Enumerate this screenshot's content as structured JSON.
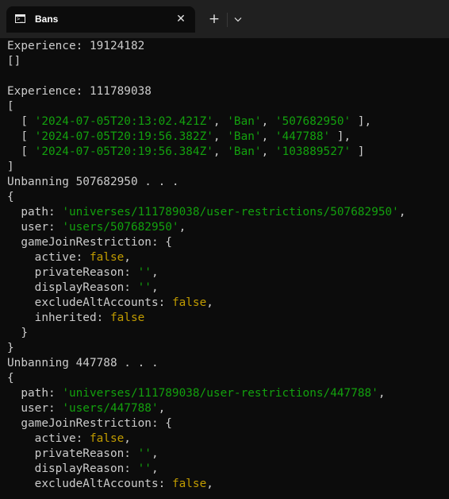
{
  "tab": {
    "title": "Bans",
    "icon": "terminal-icon",
    "close_label": "✕"
  },
  "toolbar": {
    "new_tab_label": "+",
    "new_tab_icon": "plus-icon",
    "dropdown_icon": "chevron-down-icon"
  },
  "colors": {
    "background": "#0c0c0c",
    "titlebar": "#202020",
    "text": "#cccccc",
    "string": "#13a10e",
    "literal": "#c19c00"
  },
  "terminal": {
    "lines": [
      [
        {
          "t": "Experience: 19124182"
        }
      ],
      [
        {
          "t": "[]"
        }
      ],
      [
        {
          "t": ""
        }
      ],
      [
        {
          "t": "Experience: 111789038"
        }
      ],
      [
        {
          "t": "["
        }
      ],
      [
        {
          "t": "  [ "
        },
        {
          "t": "'2024-07-05T20:13:02.421Z'",
          "c": "g"
        },
        {
          "t": ", "
        },
        {
          "t": "'Ban'",
          "c": "g"
        },
        {
          "t": ", "
        },
        {
          "t": "'507682950'",
          "c": "g"
        },
        {
          "t": " ],"
        }
      ],
      [
        {
          "t": "  [ "
        },
        {
          "t": "'2024-07-05T20:19:56.382Z'",
          "c": "g"
        },
        {
          "t": ", "
        },
        {
          "t": "'Ban'",
          "c": "g"
        },
        {
          "t": ", "
        },
        {
          "t": "'447788'",
          "c": "g"
        },
        {
          "t": " ],"
        }
      ],
      [
        {
          "t": "  [ "
        },
        {
          "t": "'2024-07-05T20:19:56.384Z'",
          "c": "g"
        },
        {
          "t": ", "
        },
        {
          "t": "'Ban'",
          "c": "g"
        },
        {
          "t": ", "
        },
        {
          "t": "'103889527'",
          "c": "g"
        },
        {
          "t": " ]"
        }
      ],
      [
        {
          "t": "]"
        }
      ],
      [
        {
          "t": "Unbanning 507682950 . . ."
        }
      ],
      [
        {
          "t": "{"
        }
      ],
      [
        {
          "t": "  path: "
        },
        {
          "t": "'universes/111789038/user-restrictions/507682950'",
          "c": "g"
        },
        {
          "t": ","
        }
      ],
      [
        {
          "t": "  user: "
        },
        {
          "t": "'users/507682950'",
          "c": "g"
        },
        {
          "t": ","
        }
      ],
      [
        {
          "t": "  gameJoinRestriction: {"
        }
      ],
      [
        {
          "t": "    active: "
        },
        {
          "t": "false",
          "c": "y"
        },
        {
          "t": ","
        }
      ],
      [
        {
          "t": "    privateReason: "
        },
        {
          "t": "''",
          "c": "g"
        },
        {
          "t": ","
        }
      ],
      [
        {
          "t": "    displayReason: "
        },
        {
          "t": "''",
          "c": "g"
        },
        {
          "t": ","
        }
      ],
      [
        {
          "t": "    excludeAltAccounts: "
        },
        {
          "t": "false",
          "c": "y"
        },
        {
          "t": ","
        }
      ],
      [
        {
          "t": "    inherited: "
        },
        {
          "t": "false",
          "c": "y"
        }
      ],
      [
        {
          "t": "  }"
        }
      ],
      [
        {
          "t": "}"
        }
      ],
      [
        {
          "t": "Unbanning 447788 . . ."
        }
      ],
      [
        {
          "t": "{"
        }
      ],
      [
        {
          "t": "  path: "
        },
        {
          "t": "'universes/111789038/user-restrictions/447788'",
          "c": "g"
        },
        {
          "t": ","
        }
      ],
      [
        {
          "t": "  user: "
        },
        {
          "t": "'users/447788'",
          "c": "g"
        },
        {
          "t": ","
        }
      ],
      [
        {
          "t": "  gameJoinRestriction: {"
        }
      ],
      [
        {
          "t": "    active: "
        },
        {
          "t": "false",
          "c": "y"
        },
        {
          "t": ","
        }
      ],
      [
        {
          "t": "    privateReason: "
        },
        {
          "t": "''",
          "c": "g"
        },
        {
          "t": ","
        }
      ],
      [
        {
          "t": "    displayReason: "
        },
        {
          "t": "''",
          "c": "g"
        },
        {
          "t": ","
        }
      ],
      [
        {
          "t": "    excludeAltAccounts: "
        },
        {
          "t": "false",
          "c": "y"
        },
        {
          "t": ","
        }
      ]
    ]
  }
}
